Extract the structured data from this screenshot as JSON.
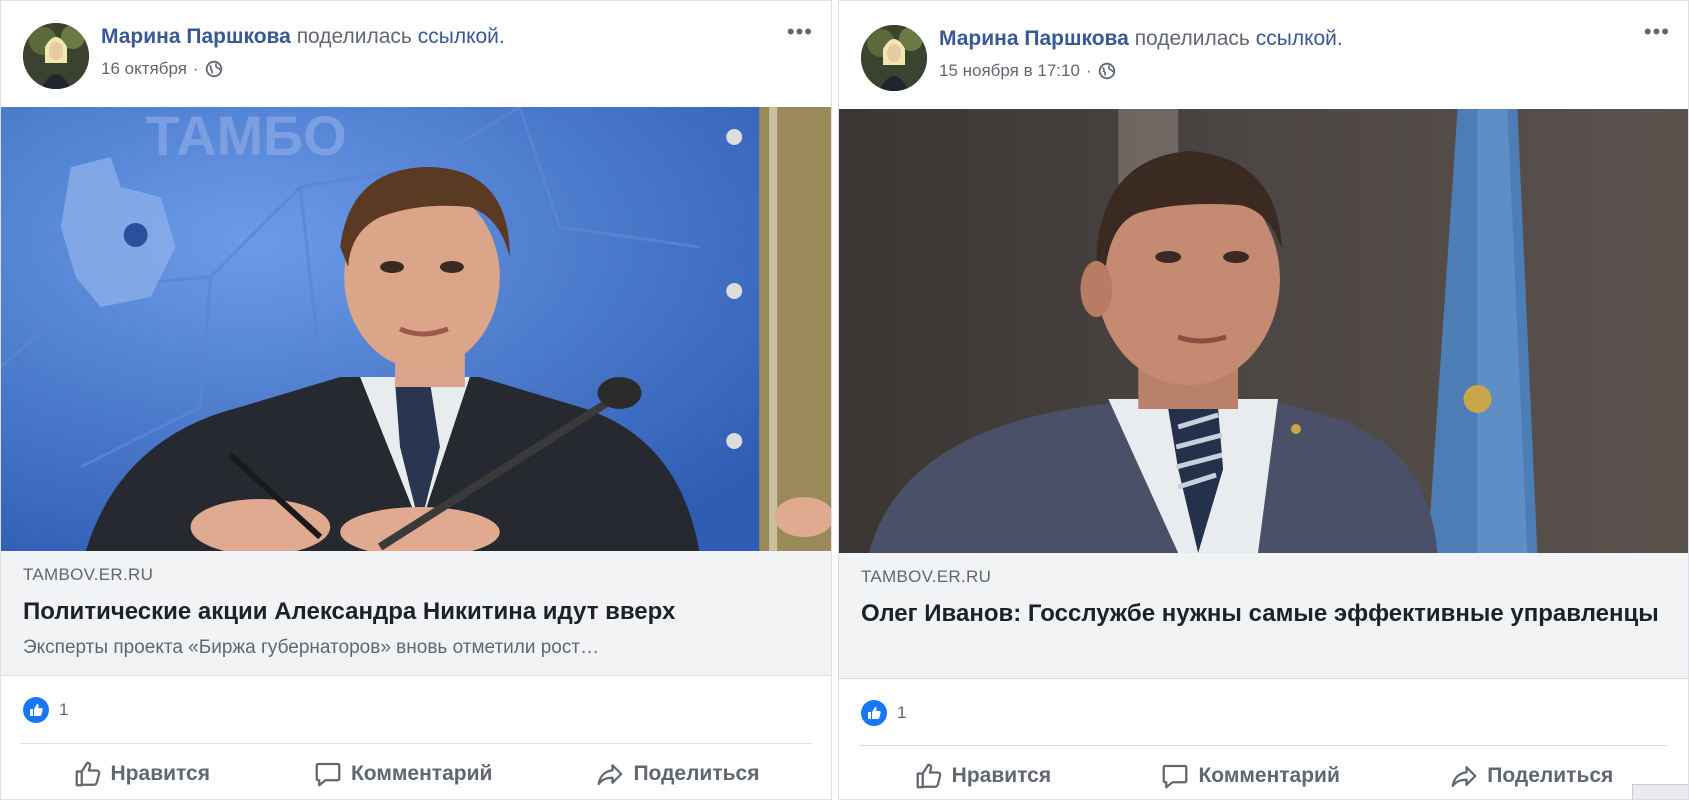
{
  "posts": [
    {
      "author": "Марина Паршкова",
      "action": "поделилась",
      "link_word": "ссылкой.",
      "date": "16 октября",
      "separator": "·",
      "more": "•••",
      "link": {
        "domain": "TAMBOV.ER.RU",
        "title": "Политические акции Александра Никитина идут вверх",
        "description": "Эксперты проекта «Биржа губернаторов» вновь отметили рост…"
      },
      "reaction_count": "1",
      "buttons": {
        "like": "Нравится",
        "comment": "Комментарий",
        "share": "Поделиться"
      }
    },
    {
      "author": "Марина Паршкова",
      "action": "поделилась",
      "link_word": "ссылкой.",
      "date": "15 ноября в 17:10",
      "separator": "·",
      "more": "•••",
      "link": {
        "domain": "TAMBOV.ER.RU",
        "title": "Олег Иванов: Госслужбе нужны самые эффективные управленцы",
        "description": ""
      },
      "reaction_count": "1",
      "buttons": {
        "like": "Нравится",
        "comment": "Комментарий",
        "share": "Поделиться"
      }
    }
  ],
  "photo_1_backdrop_text": "ТАМБО",
  "colors": {
    "link_blue": "#385898",
    "like_blue": "#1877f2",
    "link_box_bg": "#f2f3f5"
  }
}
